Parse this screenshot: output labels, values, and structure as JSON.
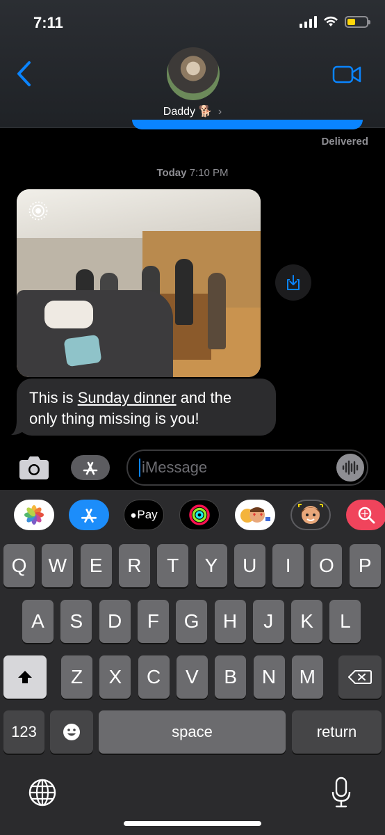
{
  "status_bar": {
    "time": "7:11"
  },
  "header": {
    "contact_name": "Daddy",
    "contact_emoji": "🐕",
    "chevron": "›"
  },
  "conversation": {
    "delivered_label": "Delivered",
    "timestamp_day": "Today",
    "timestamp_time": "7:10 PM",
    "message_part1": "This is ",
    "message_link": "Sunday dinner",
    "message_part2": " and the only thing missing is you!"
  },
  "composer": {
    "placeholder": "iMessage"
  },
  "app_strip": {
    "items": [
      "photos-app",
      "app-store",
      "apple-pay",
      "activity",
      "memoji-stickers",
      "animoji",
      "images-search"
    ],
    "apple_pay_label": "Pay"
  },
  "keyboard": {
    "row1": [
      "Q",
      "W",
      "E",
      "R",
      "T",
      "Y",
      "U",
      "I",
      "O",
      "P"
    ],
    "row2": [
      "A",
      "S",
      "D",
      "F",
      "G",
      "H",
      "J",
      "K",
      "L"
    ],
    "row3": [
      "Z",
      "X",
      "C",
      "V",
      "B",
      "N",
      "M"
    ],
    "numbers_label": "123",
    "space_label": "space",
    "return_label": "return"
  },
  "colors": {
    "accent": "#0a84ff",
    "bubble_gray": "#2c2c2e",
    "keyboard_bg": "#2b2b2d"
  }
}
